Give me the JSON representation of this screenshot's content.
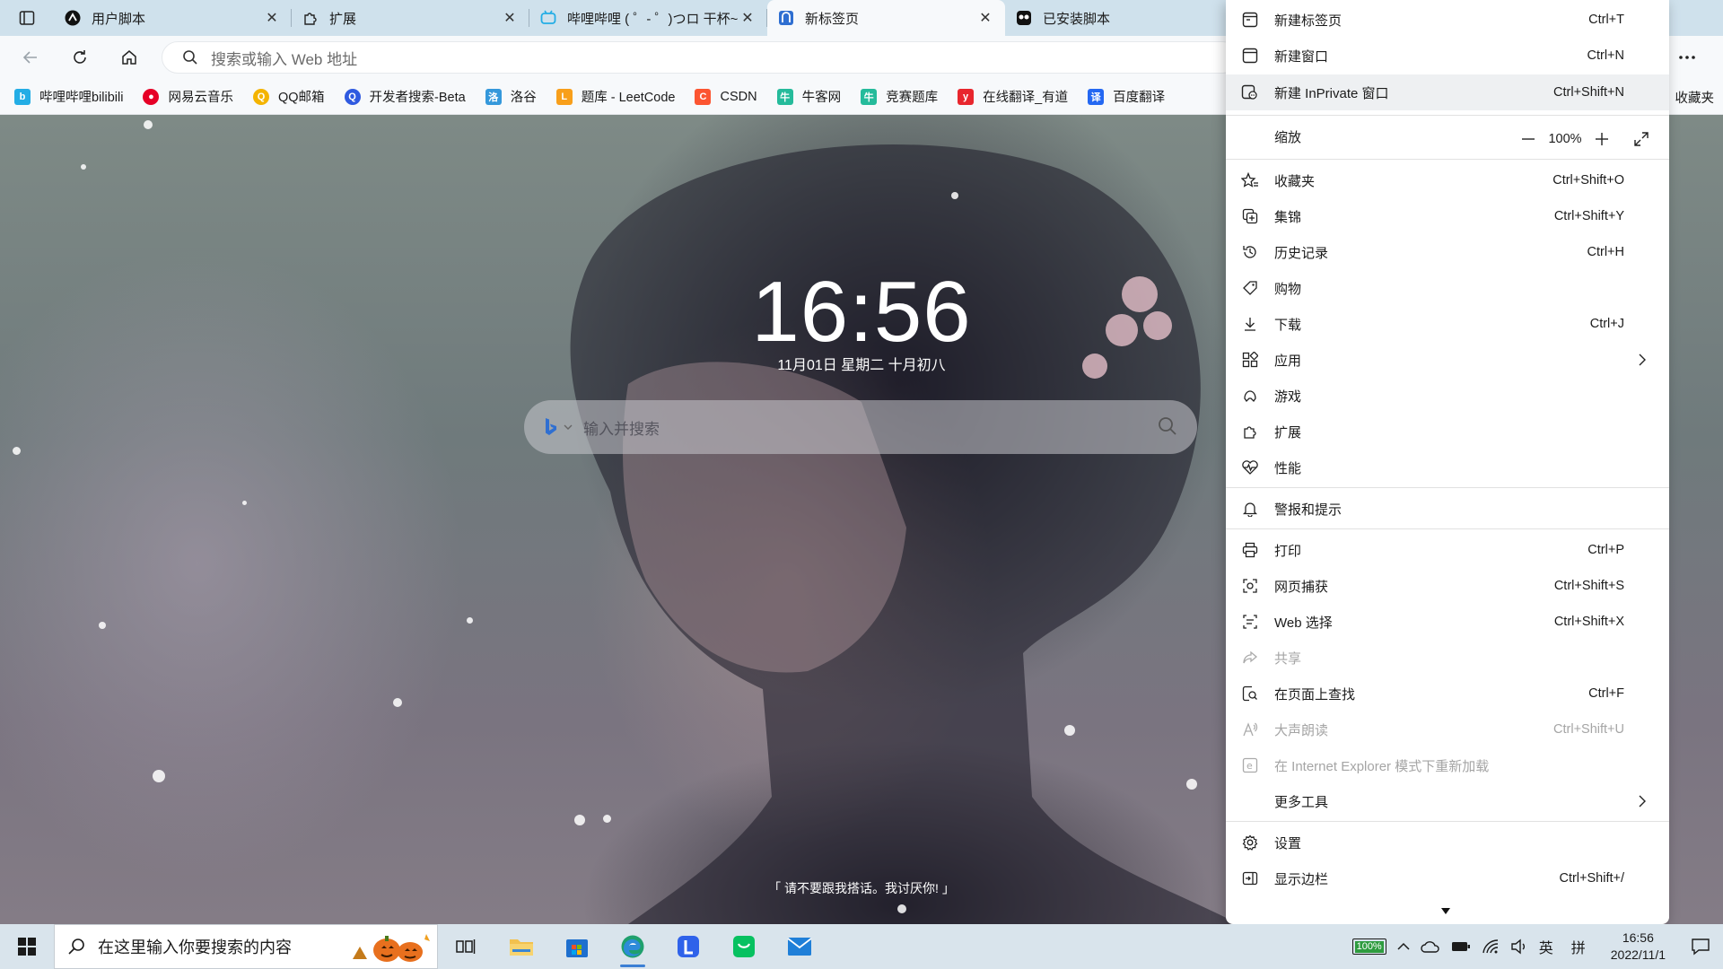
{
  "tabs": [
    {
      "title": "用户脚本",
      "icon": "tampermonkey-icon",
      "active": false
    },
    {
      "title": "扩展",
      "icon": "extension-icon",
      "active": false
    },
    {
      "title": "哔哩哔哩 ( ゜- ゜)つロ 干杯~",
      "icon": "bilibili-icon",
      "active": false
    },
    {
      "title": "新标签页",
      "icon": "newtab-icon",
      "active": true
    },
    {
      "title": "已安装脚本",
      "icon": "tampermonkey-icon",
      "active": false
    }
  ],
  "toolbar": {
    "address_placeholder": "搜索或输入 Web 地址"
  },
  "favorites": [
    {
      "label": "哔哩哔哩bilibili",
      "icon": "bilibili-icon",
      "color": "#23ade5"
    },
    {
      "label": "网易云音乐",
      "icon": "netease-music-icon",
      "color": "#e60026"
    },
    {
      "label": "QQ邮箱",
      "icon": "qq-mail-icon",
      "color": "#f4b400"
    },
    {
      "label": "开发者搜索-Beta",
      "icon": "dev-search-icon",
      "color": "#2f5ae0"
    },
    {
      "label": "洛谷",
      "icon": "luogu-icon",
      "color": "#3498db"
    },
    {
      "label": "题库 - LeetCode",
      "icon": "leetcode-icon",
      "color": "#f89f1b"
    },
    {
      "label": "CSDN",
      "icon": "csdn-icon",
      "color": "#fc5531"
    },
    {
      "label": "牛客网",
      "icon": "nowcoder-icon",
      "color": "#25bb9b"
    },
    {
      "label": "竞赛题库",
      "icon": "contest-icon",
      "color": "#25bb9b"
    },
    {
      "label": "在线翻译_有道",
      "icon": "youdao-icon",
      "color": "#e8262d"
    },
    {
      "label": "百度翻译",
      "icon": "baidu-translate-icon",
      "color": "#2468f2"
    }
  ],
  "favorites_overflow": "收藏夹",
  "newtab": {
    "time": "16:56",
    "date": "11月01日  星期二  十月初八",
    "search_placeholder": "输入并搜索",
    "quote": "「 请不要跟我搭话。我讨厌你!  」"
  },
  "menu": {
    "items": [
      {
        "label": "新建标签页",
        "shortcut": "Ctrl+T",
        "icon": "new-tab-icon"
      },
      {
        "label": "新建窗口",
        "shortcut": "Ctrl+N",
        "icon": "new-window-icon"
      },
      {
        "label": "新建 InPrivate 窗口",
        "shortcut": "Ctrl+Shift+N",
        "icon": "inprivate-icon"
      },
      {
        "label": "缩放",
        "icon": ""
      },
      {
        "label": "收藏夹",
        "shortcut": "Ctrl+Shift+O",
        "icon": "favorites-icon"
      },
      {
        "label": "集锦",
        "shortcut": "Ctrl+Shift+Y",
        "icon": "collections-icon"
      },
      {
        "label": "历史记录",
        "shortcut": "Ctrl+H",
        "icon": "history-icon"
      },
      {
        "label": "购物",
        "shortcut": "",
        "icon": "shopping-tag-icon"
      },
      {
        "label": "下载",
        "shortcut": "Ctrl+J",
        "icon": "download-icon"
      },
      {
        "label": "应用",
        "shortcut": "",
        "icon": "apps-icon"
      },
      {
        "label": "游戏",
        "shortcut": "",
        "icon": "games-icon"
      },
      {
        "label": "扩展",
        "shortcut": "",
        "icon": "extensions-icon"
      },
      {
        "label": "性能",
        "shortcut": "",
        "icon": "performance-icon"
      },
      {
        "label": "警报和提示",
        "shortcut": "",
        "icon": "bell-icon"
      },
      {
        "label": "打印",
        "shortcut": "Ctrl+P",
        "icon": "print-icon"
      },
      {
        "label": "网页捕获",
        "shortcut": "Ctrl+Shift+S",
        "icon": "web-capture-icon"
      },
      {
        "label": "Web 选择",
        "shortcut": "Ctrl+Shift+X",
        "icon": "web-select-icon"
      },
      {
        "label": "共享",
        "shortcut": "",
        "icon": "share-icon"
      },
      {
        "label": "在页面上查找",
        "shortcut": "Ctrl+F",
        "icon": "find-icon"
      },
      {
        "label": "大声朗读",
        "shortcut": "Ctrl+Shift+U",
        "icon": "read-aloud-icon"
      },
      {
        "label": "在 Internet Explorer 模式下重新加载",
        "shortcut": "",
        "icon": "ie-mode-icon"
      },
      {
        "label": "更多工具",
        "shortcut": "",
        "icon": ""
      },
      {
        "label": "设置",
        "shortcut": "",
        "icon": "settings-icon"
      },
      {
        "label": "显示边栏",
        "shortcut": "Ctrl+Shift+/",
        "icon": "sidebar-icon"
      }
    ],
    "zoom_value": "100%"
  },
  "taskbar": {
    "search_placeholder": "在这里输入你要搜索的内容",
    "battery": "100%",
    "ime": "英",
    "ime_mode": "拼",
    "time": "16:56",
    "date": "2022/11/1"
  },
  "colors": {
    "accent": "#0f6cbd",
    "tabstrip": "#cfe1ec",
    "menu_highlight": "#eef0f2"
  }
}
